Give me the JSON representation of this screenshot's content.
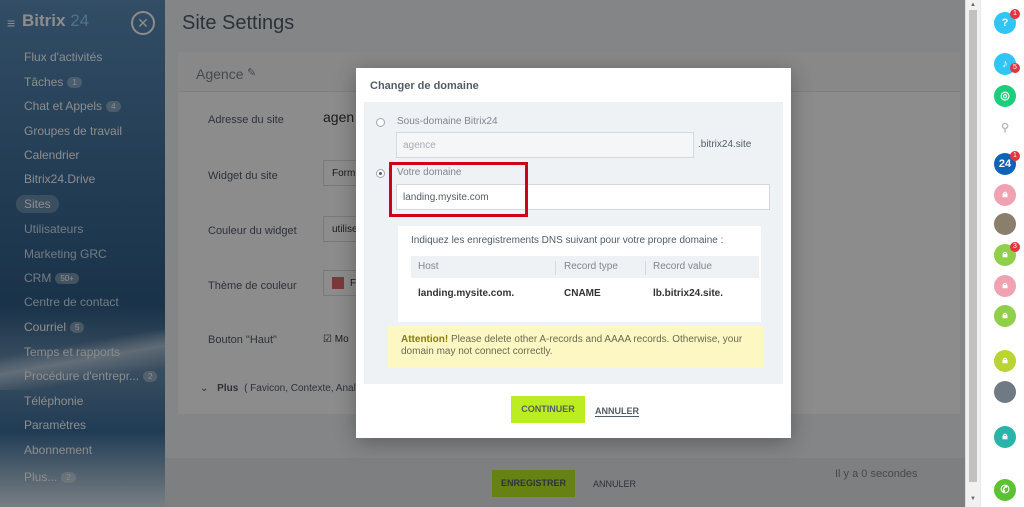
{
  "sidebar": {
    "brand_name": "Bitrix",
    "brand_num": "24",
    "items": [
      {
        "label": "Flux d'activités",
        "badge": ""
      },
      {
        "label": "Tâches",
        "badge": "1"
      },
      {
        "label": "Chat et Appels",
        "badge": "4"
      },
      {
        "label": "Groupes de travail",
        "badge": ""
      },
      {
        "label": "Calendrier",
        "badge": ""
      },
      {
        "label": "Bitrix24.Drive",
        "badge": ""
      },
      {
        "label": "Sites",
        "badge": ""
      },
      {
        "label": "Utilisateurs",
        "badge": ""
      },
      {
        "label": "Marketing GRC",
        "badge": ""
      },
      {
        "label": "CRM",
        "badge": "50+"
      },
      {
        "label": "Centre de contact",
        "badge": ""
      },
      {
        "label": "Courriel",
        "badge": "5"
      },
      {
        "label": "Temps et rapports",
        "badge": ""
      },
      {
        "label": "Procédure d'entrepr...",
        "badge": "2"
      },
      {
        "label": "Téléphonie",
        "badge": ""
      },
      {
        "label": "Paramètres",
        "badge": ""
      },
      {
        "label": "Abonnement",
        "badge": ""
      },
      {
        "label": "Plus...",
        "badge": "2"
      }
    ]
  },
  "page": {
    "title": "Site Settings",
    "card_title": "Agence",
    "rows": [
      {
        "label": "Adresse du site",
        "value": "agen"
      },
      {
        "label": "Widget du site",
        "value": "Form"
      },
      {
        "label": "Couleur du widget",
        "value": "utilise"
      },
      {
        "label": "Thème de couleur",
        "value": "F"
      },
      {
        "label": "Bouton \"Haut\"",
        "value": "Mo"
      }
    ],
    "more_label": "Plus",
    "more_details": "( Favicon,  Contexte,  Anal",
    "save_label": "ENREGISTRER",
    "cancel_label": "ANNULER",
    "saved_status": "Il y a 0 secondes"
  },
  "modal": {
    "title": "Changer de domaine",
    "option1_label": "Sous-domaine Bitrix24",
    "subdomain_placeholder": "agence",
    "subdomain_suffix": ".bitrix24.site",
    "option2_label": "Votre domaine",
    "domain_value": "landing.mysite.com",
    "dns_intro": "Indiquez les enregistrements DNS suivant pour votre propre domaine :",
    "dns_headers": [
      "Host",
      "Record type",
      "Record value"
    ],
    "dns_row": [
      "landing.mysite.com.",
      "CNAME",
      "lb.bitrix24.site."
    ],
    "attention_bold": "Attention!",
    "attention_text": "Please delete other A-records and AAAA records. Otherwise, your domain may not connect correctly.",
    "continue_label": "CONTINUER",
    "cancel_label": "ANNULER"
  },
  "rightbar": {
    "help_icon": "?",
    "help_badge": "1",
    "notif_badge": "5",
    "b24_label": "24",
    "b24_badge": "1",
    "lock_badge": "3"
  },
  "colors": {
    "accent_green": "#bbed21",
    "highlight_red": "#d0021b",
    "sidebar_blue": "#3f6f9a"
  }
}
